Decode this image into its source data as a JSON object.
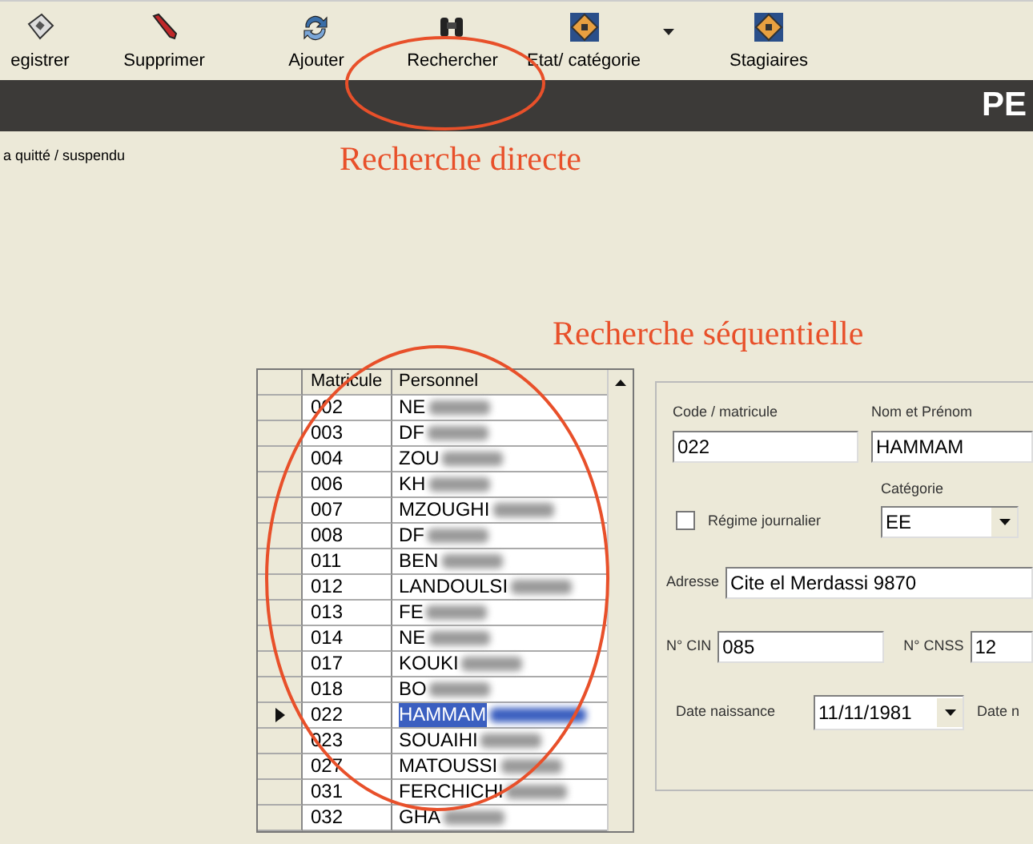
{
  "toolbar": [
    {
      "kind": "save",
      "label": "egistrer",
      "dropdown": false
    },
    {
      "kind": "pen",
      "label": "Supprimer",
      "dropdown": false
    },
    {
      "kind": "add",
      "label": "Ajouter",
      "dropdown": false
    },
    {
      "kind": "binoculars",
      "label": "Rechercher",
      "dropdown": false
    },
    {
      "kind": "badge",
      "label": "Etat/ catégorie",
      "dropdown": true
    },
    {
      "kind": "badge",
      "label": "Stagiaires",
      "dropdown": false
    }
  ],
  "header_bar": {
    "title": "PE"
  },
  "status_text": "a quitté / suspendu",
  "grid": {
    "columns": [
      "Matricule",
      "Personnel"
    ],
    "rows": [
      {
        "matricule": "002",
        "personnel": "NE",
        "selected": false
      },
      {
        "matricule": "003",
        "personnel": "DF",
        "selected": false
      },
      {
        "matricule": "004",
        "personnel": "ZOU",
        "selected": false
      },
      {
        "matricule": "006",
        "personnel": "KH",
        "selected": false
      },
      {
        "matricule": "007",
        "personnel": "MZOUGHI",
        "selected": false
      },
      {
        "matricule": "008",
        "personnel": "DF",
        "selected": false
      },
      {
        "matricule": "011",
        "personnel": "BEN",
        "selected": false
      },
      {
        "matricule": "012",
        "personnel": "LANDOULSI",
        "selected": false
      },
      {
        "matricule": "013",
        "personnel": "FE",
        "selected": false
      },
      {
        "matricule": "014",
        "personnel": "NE",
        "selected": false
      },
      {
        "matricule": "017",
        "personnel": "KOUKI",
        "selected": false
      },
      {
        "matricule": "018",
        "personnel": "BO",
        "selected": false
      },
      {
        "matricule": "022",
        "personnel": "HAMMAM",
        "selected": true
      },
      {
        "matricule": "023",
        "personnel": "SOUAIHI",
        "selected": false
      },
      {
        "matricule": "027",
        "personnel": "MATOUSSI",
        "selected": false
      },
      {
        "matricule": "031",
        "personnel": "FERCHICHI",
        "selected": false
      },
      {
        "matricule": "032",
        "personnel": "GHA",
        "selected": false
      }
    ]
  },
  "form": {
    "code": {
      "label": "Code  / matricule",
      "value": "022"
    },
    "nom": {
      "label": "Nom et Prénom",
      "value": "HAMMAM"
    },
    "categorie": {
      "label": "Catégorie",
      "value": "EE"
    },
    "regime": {
      "label": "Régime journalier",
      "checked": false
    },
    "adresse": {
      "label": "Adresse",
      "value": "Cite el Merdassi 9870"
    },
    "cin": {
      "label": "N° CIN",
      "value": "085"
    },
    "cnss": {
      "label": "N° CNSS",
      "value": "12"
    },
    "naissance": {
      "label": "Date naissance",
      "value": "11/11/1981"
    },
    "date_cut": {
      "label": "Date n"
    }
  },
  "annotations": [
    {
      "text": "Recherche directe"
    },
    {
      "text": "Recherche séquentielle"
    }
  ]
}
